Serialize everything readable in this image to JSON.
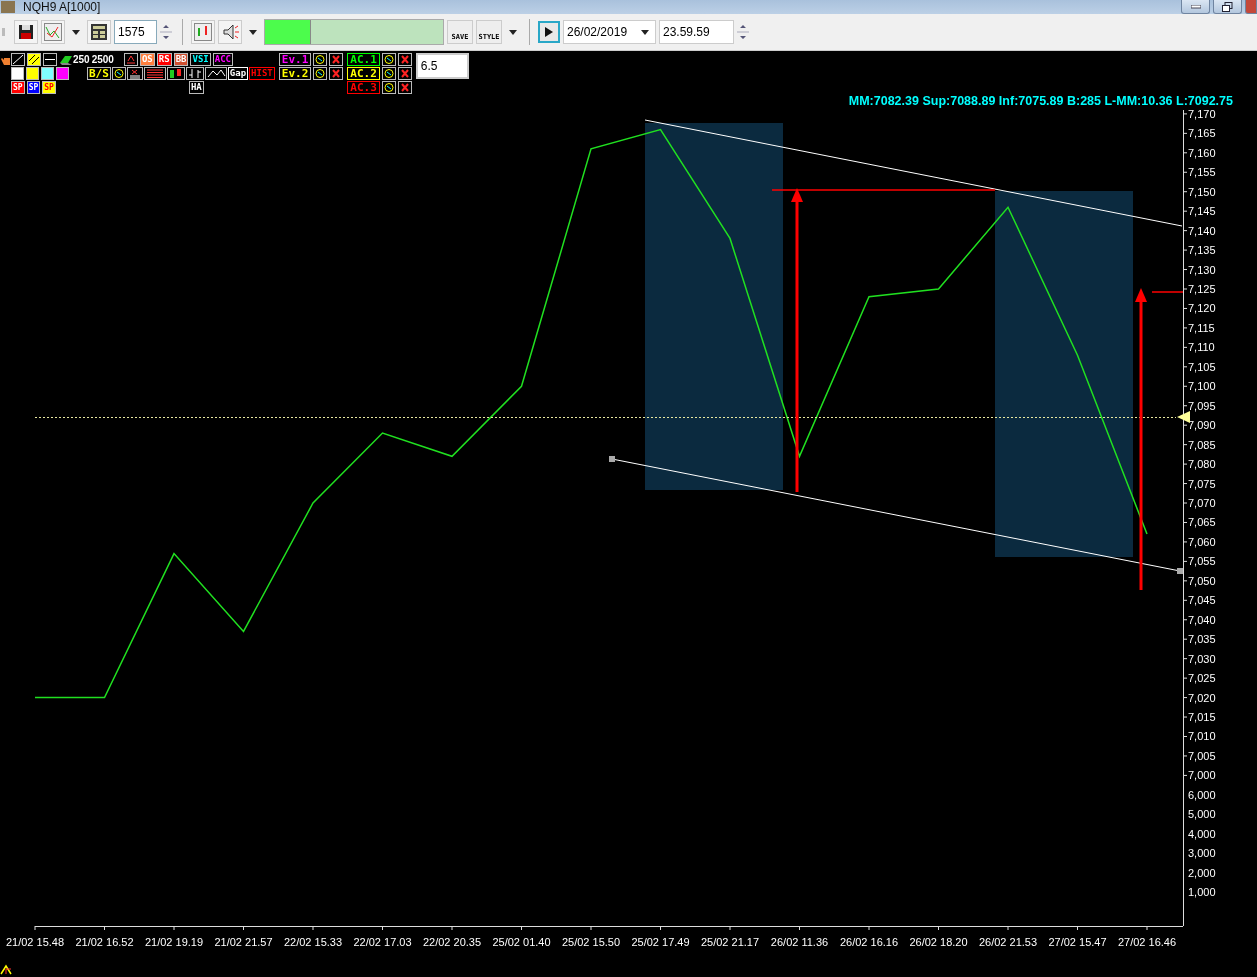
{
  "window": {
    "title": "NQH9 A[1000]"
  },
  "toolbar": {
    "bars_value": "1575",
    "progress": {
      "level": 0.25
    },
    "save_label": "SAVE",
    "style_label": "STYLE",
    "date": "26/02/2019",
    "time": "23.59.59"
  },
  "palette": {
    "swatches": [
      {
        "color": "#ffffff"
      },
      {
        "color": "#ffff00"
      },
      {
        "color": "#80ffff"
      },
      {
        "color": "#ff00ff"
      }
    ],
    "sp_buttons": [
      {
        "label": "SP",
        "color": "#ff0000"
      },
      {
        "label": "SP",
        "color": "#0000ff"
      },
      {
        "label": "SP",
        "color": "#ffff00"
      }
    ],
    "periods": [
      "250",
      "2500"
    ],
    "indicators": [
      {
        "label": "OS",
        "kind": "filled",
        "color": "#ff7f3f"
      },
      {
        "label": "RS",
        "kind": "filled",
        "color": "#ff0000"
      },
      {
        "label": "BB",
        "kind": "filled",
        "color": "#d05030"
      },
      {
        "label": "VSI",
        "kind": "outline",
        "color": "#00ffff"
      },
      {
        "label": "ACC",
        "kind": "outline",
        "color": "#ff00ff"
      }
    ],
    "bs_label": "B/S",
    "chart_styles": [
      {
        "label": "Gap",
        "color": "#ffffff"
      },
      {
        "label": "HIST",
        "color": "#ff0000"
      }
    ],
    "ha_label": "HA",
    "events": [
      {
        "label": "Ev.1",
        "color": "#ff00ff"
      },
      {
        "label": "Ev.2",
        "color": "#ffff00"
      }
    ],
    "ac": [
      {
        "label": "AC.1",
        "color": "#00ff00"
      },
      {
        "label": "AC.2",
        "color": "#ffff00"
      },
      {
        "label": "AC.3",
        "color": "#ff0000"
      }
    ],
    "value_field": "6.5"
  },
  "chart": {
    "info": "MM:7082.39 Sup:7088.89 Inf:7075.89 B:285 L-MM:10.36 L:7092.75",
    "chart_data": {
      "type": "line",
      "categories": [
        "21/02 15.48",
        "21/02 16.52",
        "21/02 19.19",
        "21/02 21.57",
        "22/02 15.33",
        "22/02 17.03",
        "22/02 20.35",
        "25/02 01.40",
        "25/02 15.50",
        "25/02 17.49",
        "25/02 21.17",
        "26/02 11.36",
        "26/02 16.16",
        "26/02 18.20",
        "26/02 21.53",
        "27/02 15.47",
        "27/02 16.46"
      ],
      "ylim": [
        6961.3,
        7171
      ],
      "series": [
        {
          "color": "#20e020",
          "values": [
            7020,
            7020,
            7057,
            7037,
            7070,
            7088,
            7082,
            7100,
            7161,
            7166,
            7138,
            7082,
            7123,
            7125,
            7146,
            7108,
            7062
          ]
        }
      ],
      "yticks": [
        {
          "value": 7170,
          "label": "7,170"
        },
        {
          "value": 7165,
          "label": "7,165"
        },
        {
          "value": 7160,
          "label": "7,160"
        },
        {
          "value": 7155,
          "label": "7,155"
        },
        {
          "value": 7150,
          "label": "7,150"
        },
        {
          "value": 7145,
          "label": "7,145"
        },
        {
          "value": 7140,
          "label": "7,140"
        },
        {
          "value": 7135,
          "label": "7,135"
        },
        {
          "value": 7130,
          "label": "7,130"
        },
        {
          "value": 7125,
          "label": "7,125"
        },
        {
          "value": 7120,
          "label": "7,120"
        },
        {
          "value": 7115,
          "label": "7,115"
        },
        {
          "value": 7110,
          "label": "7,110"
        },
        {
          "value": 7105,
          "label": "7,105"
        },
        {
          "value": 7100,
          "label": "7,100"
        },
        {
          "value": 7095,
          "label": "7,095"
        },
        {
          "value": 7090,
          "label": "7,090"
        },
        {
          "value": 7085,
          "label": "7,085"
        },
        {
          "value": 7080,
          "label": "7,080"
        },
        {
          "value": 7075,
          "label": "7,075"
        },
        {
          "value": 7070,
          "label": "7,070"
        },
        {
          "value": 7065,
          "label": "7,065"
        },
        {
          "value": 7060,
          "label": "7,060"
        },
        {
          "value": 7055,
          "label": "7,055"
        },
        {
          "value": 7050,
          "label": "7,050"
        },
        {
          "value": 7045,
          "label": "7,045"
        },
        {
          "value": 7040,
          "label": "7,040"
        },
        {
          "value": 7035,
          "label": "7,035"
        },
        {
          "value": 7030,
          "label": "7,030"
        },
        {
          "value": 7025,
          "label": "7,025"
        },
        {
          "value": 7020,
          "label": "7,020"
        },
        {
          "value": 7015,
          "label": "7,015"
        },
        {
          "value": 7010,
          "label": "7,010"
        },
        {
          "value": 7005,
          "label": "7,005"
        },
        {
          "value": 7000,
          "label": "7,000"
        }
      ]
    },
    "extra_axis_labels": [
      "6,000",
      "5,000",
      "4,000",
      "3,000",
      "2,000",
      "1,000"
    ]
  }
}
